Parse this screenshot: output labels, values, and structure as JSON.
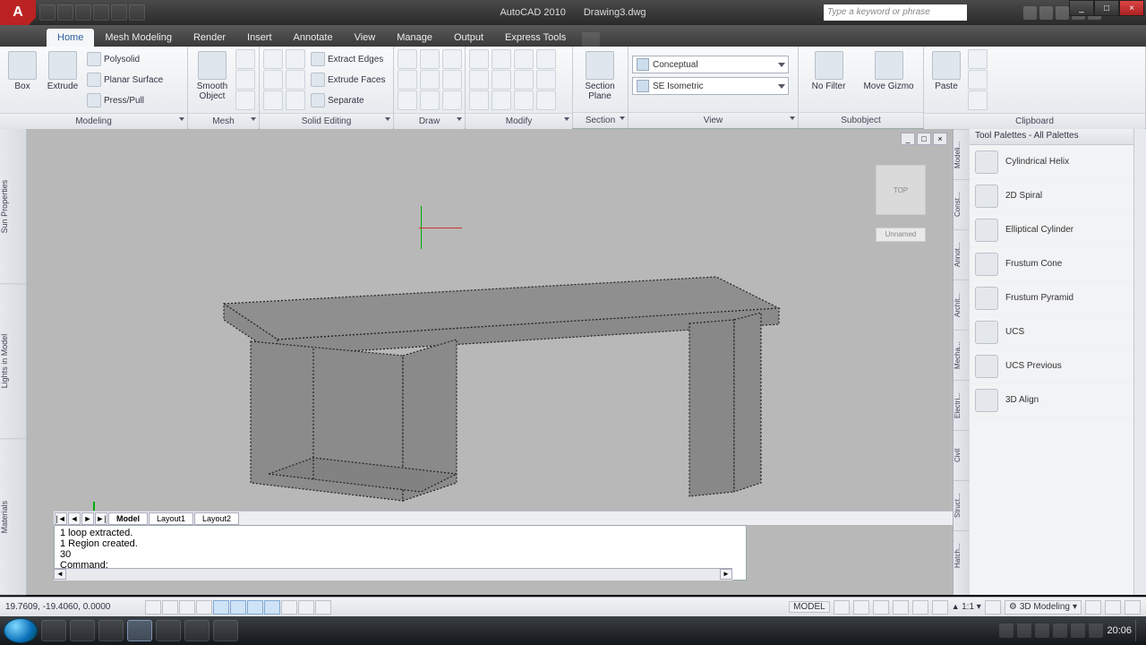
{
  "app": {
    "name": "AutoCAD 2010",
    "document": "Drawing3.dwg",
    "logo_letter": "A"
  },
  "search": {
    "placeholder": "Type a keyword or phrase"
  },
  "window_controls": {
    "min": "_",
    "max": "□",
    "close": "×"
  },
  "tabs": [
    "Home",
    "Mesh Modeling",
    "Render",
    "Insert",
    "Annotate",
    "View",
    "Manage",
    "Output",
    "Express Tools"
  ],
  "active_tab": "Home",
  "ribbon": {
    "panels": [
      {
        "title": "Modeling",
        "big": [
          {
            "label": "Box"
          },
          {
            "label": "Extrude"
          }
        ],
        "rows": [
          {
            "label": "Polysolid"
          },
          {
            "label": "Planar Surface"
          },
          {
            "label": "Press/Pull"
          }
        ]
      },
      {
        "title": "Mesh",
        "big": [
          {
            "label": "Smooth Object"
          }
        ],
        "grid_cols": 3
      },
      {
        "title": "Solid Editing",
        "rows": [
          {
            "label": "Extract Edges"
          },
          {
            "label": "Extrude Faces"
          },
          {
            "label": "Separate"
          }
        ],
        "grid_cols": 3
      },
      {
        "title": "Draw",
        "grid_cols": 3
      },
      {
        "title": "Modify",
        "grid_cols": 4
      },
      {
        "title": "Section",
        "big": [
          {
            "label": "Section Plane"
          }
        ]
      },
      {
        "title": "View",
        "combos": [
          {
            "label": "Conceptual"
          },
          {
            "label": "SE Isometric"
          }
        ]
      },
      {
        "title": "Subobject",
        "big": [
          {
            "label": "No Filter"
          },
          {
            "label": "Move Gizmo"
          }
        ]
      },
      {
        "title": "Clipboard",
        "big": [
          {
            "label": "Paste"
          }
        ],
        "grid_cols": 1
      }
    ]
  },
  "left_rail": [
    "Sun Properties",
    "Lights in Model",
    "Materials"
  ],
  "viewport": {
    "viewcube_face": "TOP",
    "unnamed": "Unnamed"
  },
  "doc_tabs": {
    "items": [
      "Model",
      "Layout1",
      "Layout2"
    ],
    "active": "Model"
  },
  "command": {
    "lines": [
      "1 loop extracted.",
      "1 Region created.",
      "30"
    ],
    "prompt": "Command:"
  },
  "palettes": {
    "title": "Tool Palettes - All Palettes",
    "vtabs": [
      "Modeli...",
      "Const...",
      "Annot...",
      "Archit...",
      "Mecha...",
      "Electri...",
      "Civil",
      "Struct...",
      "Hatch..."
    ],
    "items": [
      "Cylindrical Helix",
      "2D Spiral",
      "Elliptical Cylinder",
      "Frustum Cone",
      "Frustum Pyramid",
      "UCS",
      "UCS Previous",
      "3D Align"
    ]
  },
  "status": {
    "coords": "19.7609, -19.4060, 0.0000",
    "model_label": "MODEL",
    "scale": "1:1",
    "workspace": "3D Modeling"
  },
  "taskbar": {
    "clock": "20:06"
  }
}
